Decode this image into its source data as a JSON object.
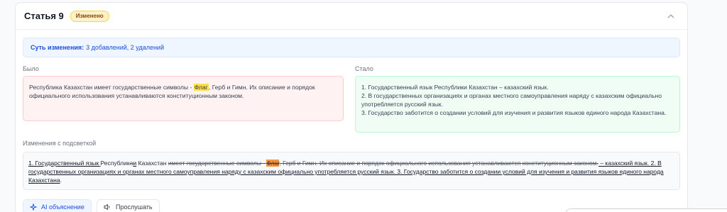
{
  "article": {
    "title": "Статья 9",
    "status_badge": "Изменено"
  },
  "summary": {
    "label": "Суть изменения:",
    "text": "3 добавлений, 2 удалений"
  },
  "before": {
    "label": "Было",
    "text_part1": "Республика Казахстан имеет государственные символы - ",
    "highlight": "Флаг",
    "text_part2": ", Герб и Гимн. Их описание и порядок официального использования устанавливаются конституционным законом."
  },
  "after": {
    "label": "Стало",
    "lines": [
      "1. Государственный язык Республики Казахстан – казахский язык.",
      "2. В государственных организациях и органах местного самоуправления наряду с казахским официально употребляется русский язык.",
      "3. Государство заботится о создании условий для изучения и развития языков единого народа Казахстана."
    ]
  },
  "diff": {
    "label": "Изменения с подсветкой",
    "ins1": "1. Государственный язык ",
    "plain1": "Республик",
    "del1": "а",
    "ins2": "и",
    "plain2": " Казахстан ",
    "del2": "имеет государственные символы - ",
    "del_hl": "Флаг",
    "del3": ", Герб и Гимн. Их описание и порядок официального использования устанавливаются конституционным законом.",
    "ins3": " – казахский язык. 2. В государственных организациях и органах местного самоуправления наряду с казахским официально употребляется русский язык. 3. Государство заботится о создании условий для изучения и развития языков единого народа Казахстана",
    "plain3": "."
  },
  "actions": {
    "ai_label": "AI объяснение",
    "listen_label": "Прослушать"
  },
  "colors": {
    "accent": "#1d4ed8",
    "highlight": "#fde047",
    "deleted_highlight": "#fb923c"
  }
}
